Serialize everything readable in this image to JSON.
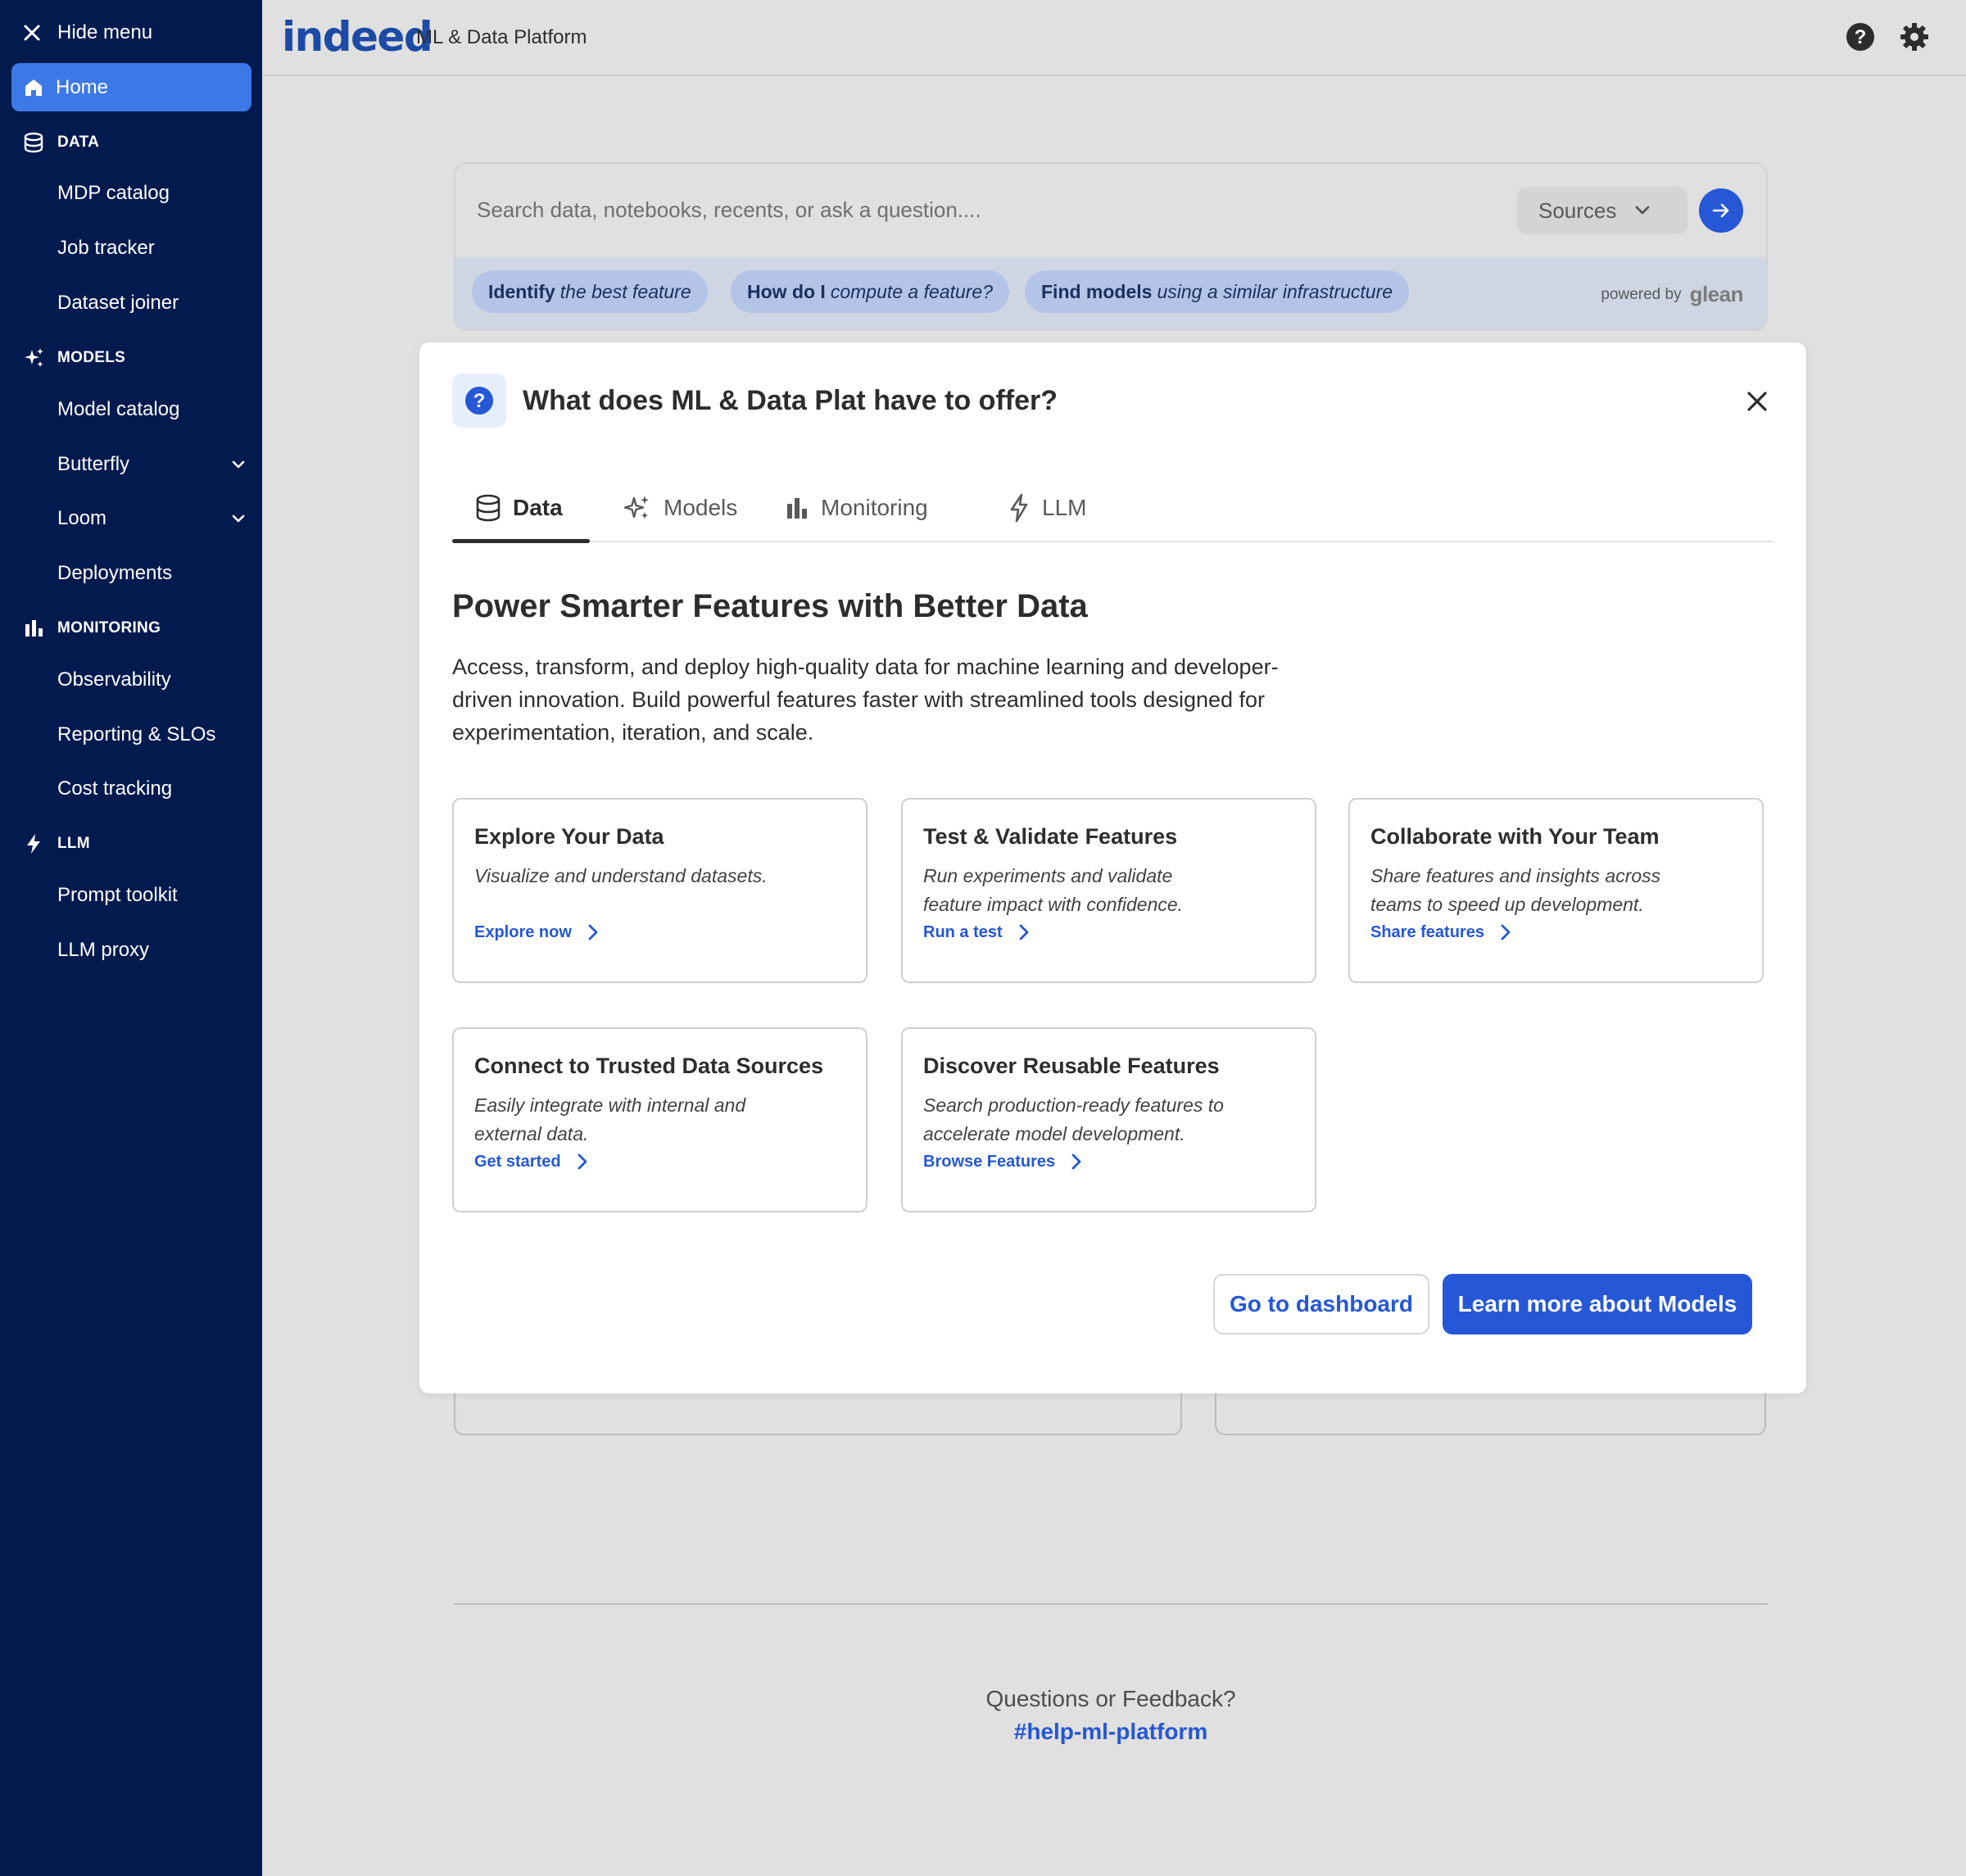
{
  "sidebar": {
    "hide_menu": "Hide menu",
    "home": "Home",
    "sections": [
      {
        "label": "DATA",
        "icon": "database-icon",
        "items": [
          "MDP catalog",
          "Job tracker",
          "Dataset joiner"
        ]
      },
      {
        "label": "MODELS",
        "icon": "sparkles-icon",
        "items": [
          "Model catalog",
          "Butterfly",
          "Loom",
          "Deployments"
        ]
      },
      {
        "label": "MONITORING",
        "icon": "bar-chart-icon",
        "items": [
          "Observability",
          "Reporting & SLOs",
          "Cost tracking"
        ]
      },
      {
        "label": "LLM",
        "icon": "lightning-icon",
        "items": [
          "Prompt toolkit",
          "LLM proxy"
        ]
      }
    ]
  },
  "header": {
    "logo": "indeed",
    "product": "ML & Data Platform",
    "help_icon": "help-icon",
    "settings_icon": "gear-icon"
  },
  "search": {
    "placeholder": "Search data, notebooks, recents, or ask a question....",
    "sources_label": "Sources",
    "chips": [
      {
        "bold": "Identify",
        "rest": "the best feature"
      },
      {
        "bold": "How do I",
        "rest": "compute a feature?"
      },
      {
        "bold": "Find models",
        "rest": "using a similar infrastructure"
      }
    ],
    "powered_by": "powered by",
    "powered_brand": "glean"
  },
  "modal": {
    "title": "What does ML & Data Plat have to offer?",
    "tabs": [
      {
        "label": "Data",
        "icon": "database-icon",
        "active": true
      },
      {
        "label": "Models",
        "icon": "sparkles-icon",
        "active": false
      },
      {
        "label": "Monitoring",
        "icon": "bar-chart-icon",
        "active": false
      },
      {
        "label": "LLM",
        "icon": "lightning-icon",
        "active": false
      }
    ],
    "heading": "Power Smarter Features with Better Data",
    "lead": "Access, transform, and deploy high-quality data for machine learning and developer-driven innovation. Build powerful features faster with streamlined tools designed for experimentation, iteration, and scale.",
    "cards": [
      {
        "title": "Explore Your Data",
        "desc": "Visualize and understand datasets.",
        "link": "Explore now"
      },
      {
        "title": "Test & Validate Features",
        "desc": "Run experiments and validate feature impact with confidence.",
        "link": "Run a test"
      },
      {
        "title": "Collaborate with Your Team",
        "desc": "Share features and insights across teams to speed up development.",
        "link": "Share features"
      },
      {
        "title": "Connect to Trusted Data Sources",
        "desc": "Easily integrate with internal and external data.",
        "link": "Get started"
      },
      {
        "title": "Discover Reusable Features",
        "desc": "Search production-ready features to accelerate model development.",
        "link": "Browse Features"
      }
    ],
    "secondary_button": "Go to dashboard",
    "primary_button": "Learn more about Models"
  },
  "footer": {
    "question": "Questions or Feedback?",
    "channel": "#help-ml-platform"
  },
  "colors": {
    "sidebar_bg": "#031a4f",
    "active_nav": "#3d79e6",
    "brand_blue": "#2557d6",
    "chip_bg": "#b3c4e6"
  }
}
